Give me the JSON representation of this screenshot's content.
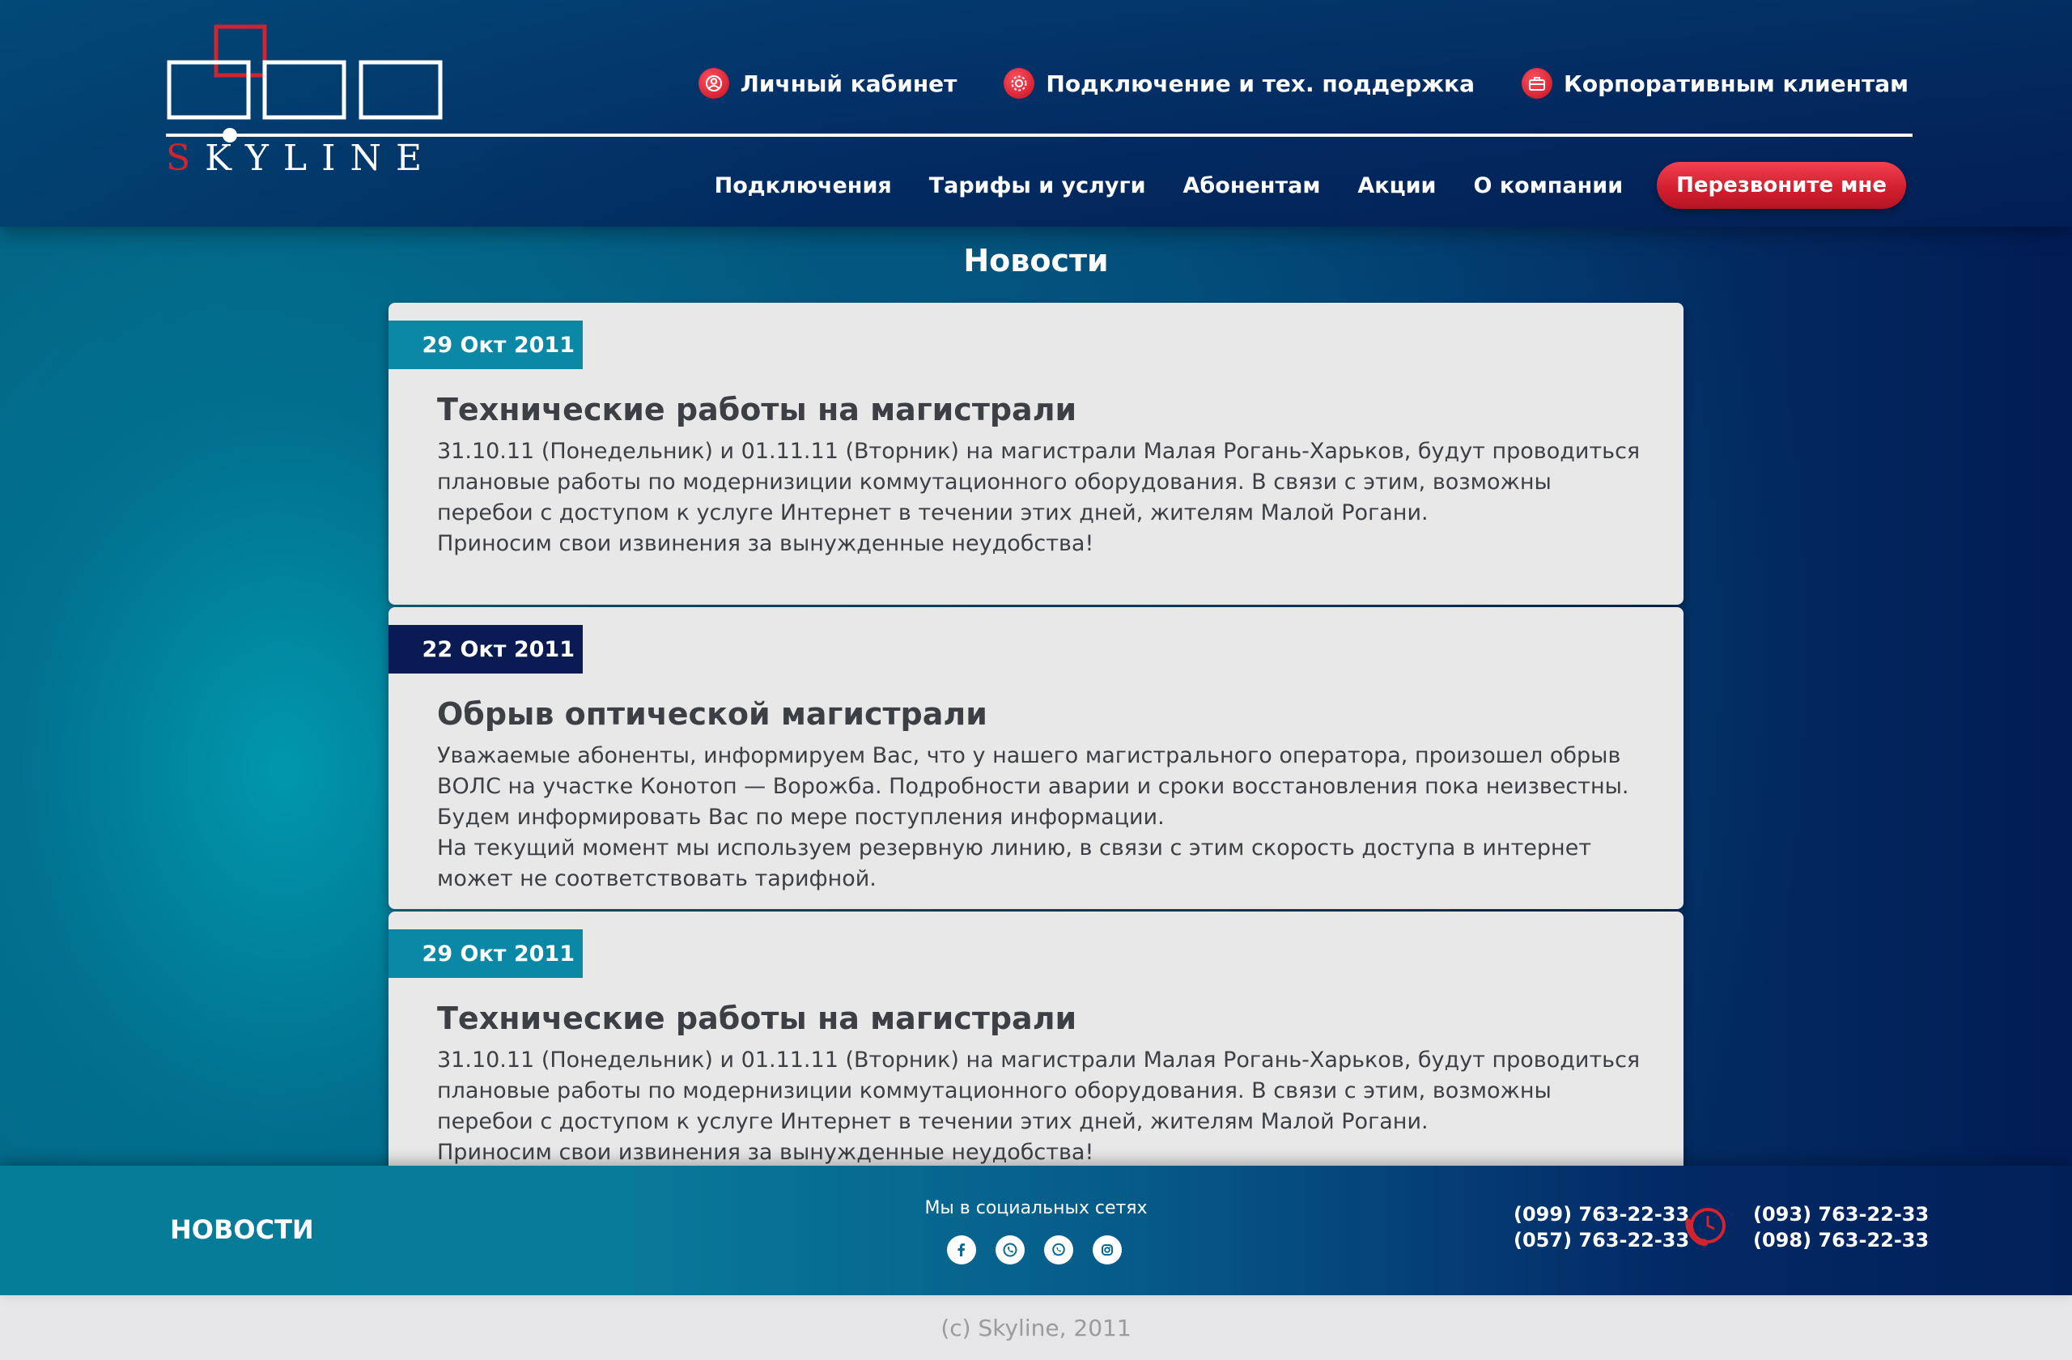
{
  "brand": {
    "logo_text_first": "S",
    "logo_text_rest": "KYLINE"
  },
  "top_links": [
    {
      "label": "Личный кабинет",
      "icon": "user-icon"
    },
    {
      "label": "Подключение и тех. поддержка",
      "icon": "gear-icon"
    },
    {
      "label": "Корпоративным клиентам",
      "icon": "briefcase-icon"
    }
  ],
  "nav": {
    "items": [
      "Подключения",
      "Тарифы и услуги",
      "Абонентам",
      "Акции",
      "О компании"
    ],
    "callback_label": "Перезвоните мне"
  },
  "page_title": "Новости",
  "news": [
    {
      "date": "29 Окт 2011",
      "title": "Технические работы на магистрали",
      "body": "31.10.11 (Понедельник) и 01.11.11 (Вторник) на магистрали Малая Рогань-Харьков, будут проводиться\nплановые работы по модернизиции коммутационного оборудования. В связи с этим, возможны\nперебои с доступом к услуге Интернет в течении этих дней, жителям Малой Рогани.\nПриносим свои извинения за вынужденные неудобства!"
    },
    {
      "date": "22 Окт 2011",
      "title": "Обрыв оптической магистрали",
      "body": "Уважаемые абоненты, информируем Вас, что у нашего магистрального оператора, произошел обрыв\nВОЛС на участке Конотоп — Ворожба. Подробности аварии и сроки восстановления пока неизвестны.\nБудем информировать Вас по мере поступления информации.\nНа текущий момент мы используем резервную линию, в связи с этим скорость доступа в интернет\nможет не соответствовать тарифной."
    },
    {
      "date": "29 Окт 2011",
      "title": "Технические работы на магистрали",
      "body": "31.10.11 (Понедельник) и 01.11.11 (Вторник) на магистрали Малая Рогань-Харьков, будут проводиться\nплановые работы по модернизиции коммутационного оборудования. В связи с этим, возможны\nперебои с доступом к услуге Интернет в течении этих дней, жителям Малой Рогани.\nПриносим свои извинения за вынужденные неудобства!"
    }
  ],
  "footer": {
    "section_label": "НОВОСТИ",
    "social_label": "Мы в социальных сетях",
    "social_icons": [
      "facebook-icon",
      "viber-icon",
      "whatsapp-icon",
      "instagram-icon"
    ],
    "phones_left": [
      "(099) 763-22-33",
      "(057) 763-22-33"
    ],
    "phones_right": [
      "(093) 763-22-33",
      "(098) 763-22-33"
    ]
  },
  "copyright": "(c) Skyline, 2011",
  "colors": {
    "accent_red": "#d1242e",
    "date_teal": "#0a88a6",
    "date_navy": "#0a1a52"
  }
}
